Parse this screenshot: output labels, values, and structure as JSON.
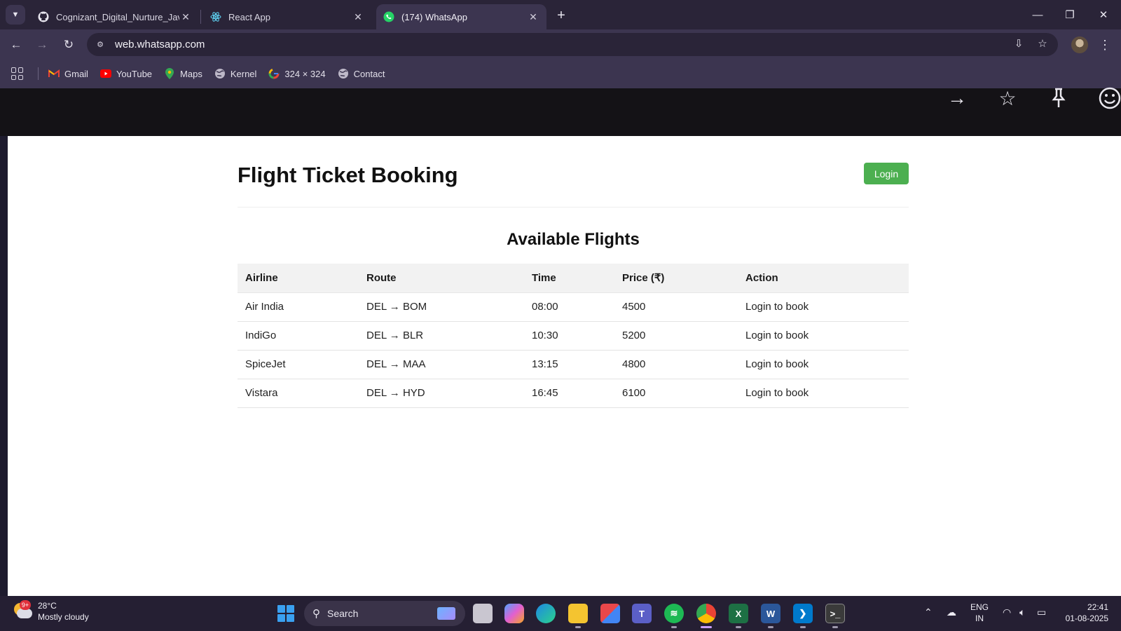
{
  "browser": {
    "tabs": [
      {
        "title": "Cognizant_Digital_Nurture_Java",
        "icon": "github-icon",
        "active": false
      },
      {
        "title": "React App",
        "icon": "react-icon",
        "active": false
      },
      {
        "title": "(174) WhatsApp",
        "icon": "whatsapp-icon",
        "active": true
      }
    ],
    "tab_close_glyph": "✕",
    "new_tab_glyph": "+",
    "url": "web.whatsapp.com",
    "bookmarks": [
      {
        "label": "Gmail",
        "icon": "gmail-icon"
      },
      {
        "label": "YouTube",
        "icon": "youtube-icon"
      },
      {
        "label": "Maps",
        "icon": "maps-icon"
      },
      {
        "label": "Kernel",
        "icon": "globe-icon"
      },
      {
        "label": "324 × 324",
        "icon": "google-icon"
      },
      {
        "label": "Contact",
        "icon": "globe-icon"
      }
    ]
  },
  "page": {
    "title": "Flight Ticket Booking",
    "login_label": "Login",
    "section_title": "Available Flights",
    "table": {
      "headers": [
        "Airline",
        "Route",
        "Time",
        "Price (₹)",
        "Action"
      ],
      "rows": [
        {
          "airline": "Air India",
          "route": "DEL → BOM",
          "time": "08:00",
          "price": "4500",
          "action": "Login to book"
        },
        {
          "airline": "IndiGo",
          "route": "DEL → BLR",
          "time": "10:30",
          "price": "5200",
          "action": "Login to book"
        },
        {
          "airline": "SpiceJet",
          "route": "DEL → MAA",
          "time": "13:15",
          "price": "4800",
          "action": "Login to book"
        },
        {
          "airline": "Vistara",
          "route": "DEL → HYD",
          "time": "16:45",
          "price": "6100",
          "action": "Login to book"
        }
      ]
    },
    "colors": {
      "login_button": "#4caf50",
      "header_row": "#f2f2f2"
    }
  },
  "taskbar": {
    "weather": {
      "temp": "28°C",
      "condition": "Mostly cloudy",
      "badge": "9+"
    },
    "search_label": "Search",
    "language": {
      "line1": "ENG",
      "line2": "IN"
    },
    "clock": {
      "time": "22:41",
      "date": "01-08-2025"
    }
  }
}
